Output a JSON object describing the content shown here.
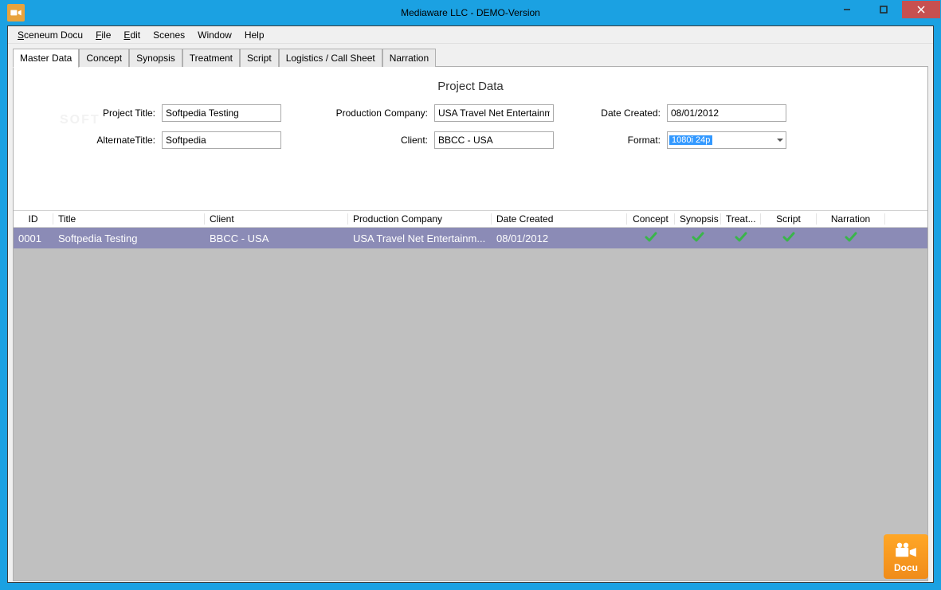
{
  "window": {
    "title": "Mediaware LLC - DEMO-Version"
  },
  "menu": {
    "items": [
      "Sceneum Docu",
      "File",
      "Edit",
      "Scenes",
      "Window",
      "Help"
    ]
  },
  "tabs": {
    "items": [
      "Master Data",
      "Concept",
      "Synopsis",
      "Treatment",
      "Script",
      "Logistics / Call Sheet",
      "Narration"
    ],
    "active": 0
  },
  "section_title": "Project Data",
  "form": {
    "project_title_label": "Project Title:",
    "project_title": "Softpedia Testing",
    "alternate_title_label": "AlternateTitle:",
    "alternate_title": "Softpedia",
    "production_company_label": "Production Company:",
    "production_company": "USA Travel Net Entertainm",
    "client_label": "Client:",
    "client": "BBCC - USA",
    "date_created_label": "Date Created:",
    "date_created": "08/01/2012",
    "format_label": "Format:",
    "format": "1080i 24p"
  },
  "table": {
    "headers": {
      "id": "ID",
      "title": "Title",
      "client": "Client",
      "company": "Production Company",
      "date": "Date Created",
      "concept": "Concept",
      "synopsis": "Synopsis",
      "treat": "Treat...",
      "script": "Script",
      "narr": "Narration"
    },
    "rows": [
      {
        "id": "0001",
        "title": "Softpedia Testing",
        "client": "BBCC - USA",
        "company": "USA Travel Net Entertainm...",
        "date": "08/01/2012",
        "concept": true,
        "synopsis": true,
        "treat": true,
        "script": true,
        "narr": true
      }
    ]
  },
  "brand_label": "Docu",
  "watermark": "SOFT"
}
